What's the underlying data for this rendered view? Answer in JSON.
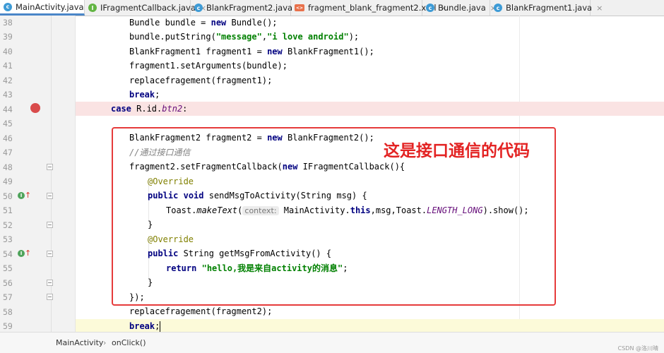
{
  "tabs": [
    {
      "label": "MainActivity.java",
      "icon": "class-icon",
      "active": true
    },
    {
      "label": "IFragmentCallback.java",
      "icon": "interface-icon",
      "active": false
    },
    {
      "label": "BlankFragment2.java",
      "icon": "class-icon",
      "active": false
    },
    {
      "label": "fragment_blank_fragment2.xml",
      "icon": "xml-file-icon",
      "active": false
    },
    {
      "label": "Bundle.java",
      "icon": "class-icon",
      "active": false
    },
    {
      "label": "BlankFragment1.java",
      "icon": "class-icon",
      "active": false
    }
  ],
  "tab_close": "×",
  "line_numbers": [
    "38",
    "39",
    "40",
    "41",
    "42",
    "43",
    "44",
    "45",
    "46",
    "47",
    "48",
    "49",
    "50",
    "51",
    "52",
    "53",
    "54",
    "55",
    "56",
    "57",
    "58",
    "59"
  ],
  "gutter_markers": {
    "override_badge": "I",
    "override_arrow": "↑"
  },
  "code": {
    "l38": {
      "a": "Bundle bundle = ",
      "b": "new",
      "c": " Bundle();"
    },
    "l39": {
      "a": "bundle.putString(",
      "b": "\"message\"",
      "c": ",",
      "d": "\"i love android\"",
      "e": ");"
    },
    "l40": {
      "a": "BlankFragment1 fragment1 = ",
      "b": "new",
      "c": " BlankFragment1();"
    },
    "l41": {
      "a": "fragment1.setArguments(bundle);"
    },
    "l42": {
      "a": "replacefragement(fragment1);"
    },
    "l43": {
      "a": "break",
      "b": ";"
    },
    "l44": {
      "a": "case",
      "b": " R.id.",
      "c": "btn2",
      "d": ":"
    },
    "l46": {
      "a": "BlankFragment2 fragment2 = ",
      "b": "new",
      "c": " BlankFragment2();"
    },
    "l47": {
      "a": "//通过接口通信"
    },
    "l48": {
      "a": "fragment2.setFragmentCallback(",
      "b": "new",
      "c": " IFragmentCallback(){"
    },
    "l49": {
      "a": "@Override"
    },
    "l50": {
      "a": "public",
      "b": " ",
      "c": "void",
      "d": " sendMsgToActivity(String msg) {"
    },
    "l51": {
      "a": "Toast.",
      "b": "makeText",
      "c": "(",
      "hint": "context:",
      "d": " MainActivity.",
      "e": "this",
      "f": ",msg,Toast.",
      "g": "LENGTH_LONG",
      "h": ").show();"
    },
    "l52": {
      "a": "}"
    },
    "l53": {
      "a": "@Override"
    },
    "l54": {
      "a": "public",
      "b": " String getMsgFromActivity() {"
    },
    "l55": {
      "a": "return",
      "b": " ",
      "c": "\"hello,我是来自activity的消息\"",
      "d": ";"
    },
    "l56": {
      "a": "}"
    },
    "l57": {
      "a": "});"
    },
    "l58": {
      "a": "replacefragement(fragment2);"
    },
    "l59": {
      "a": "break",
      "b": ";"
    }
  },
  "annotation": {
    "text": "这是接口通信的代码",
    "color": "#e32323"
  },
  "breadcrumb": {
    "class": "MainActivity",
    "separator": "›",
    "method": "onClick()"
  },
  "watermark": "CSDN @洛川晴",
  "colors": {
    "keyword": "#000080",
    "string": "#008000",
    "comment": "#808080",
    "annotation": "#808000",
    "highlight_breakpoint": "#fae3e3",
    "highlight_current": "#fcfad9",
    "active_tab_underline": "#4a86c8"
  }
}
